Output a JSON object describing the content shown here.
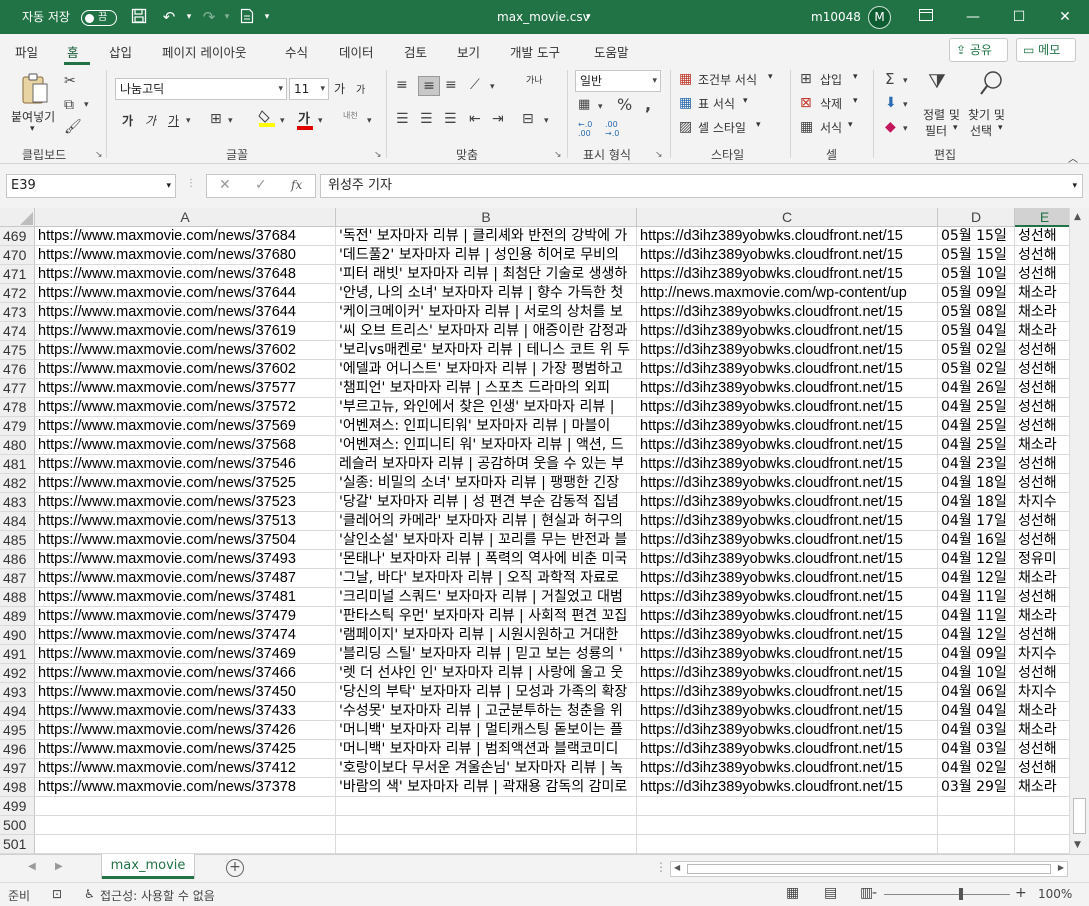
{
  "titlebar": {
    "autosave_label": "자동 저장",
    "autosave_state": "끔",
    "filename": "max_movie.csv",
    "user_name": "m10048",
    "user_initial": "M"
  },
  "menu": {
    "tabs": [
      "파일",
      "홈",
      "삽입",
      "페이지 레이아웃",
      "수식",
      "데이터",
      "검토",
      "보기",
      "개발 도구",
      "도움말"
    ],
    "share_label": "공유",
    "memo_label": "메모"
  },
  "ribbon": {
    "clipboard": {
      "paste_label": "붙여넣기",
      "group_label": "클립보드"
    },
    "font": {
      "font_name": "나눔고딕",
      "font_size": "11",
      "group_label": "글꼴",
      "bold": "가",
      "italic": "가",
      "underline": "가",
      "grow": "가",
      "shrink": "가",
      "color_glyph": "가",
      "phonetic": "내천"
    },
    "alignment": {
      "group_label": "맞춤",
      "wrap": "가나"
    },
    "number": {
      "format": "일반",
      "group_label": "표시 형식"
    },
    "styles": {
      "conditional": "조건부 서식",
      "table": "표 서식",
      "cell": "셀 스타일",
      "group_label": "스타일"
    },
    "cells": {
      "insert": "삽입",
      "delete": "삭제",
      "format": "서식",
      "group_label": "셀"
    },
    "editing": {
      "sort": "정렬 및",
      "sort2": "필터",
      "find": "찾기 및",
      "find2": "선택",
      "group_label": "편집"
    }
  },
  "formula": {
    "name_box": "E39",
    "content": "위성주 기자"
  },
  "columns": [
    "A",
    "B",
    "C",
    "D",
    "E"
  ],
  "rows": [
    {
      "n": "469",
      "a": "https://www.maxmovie.com/news/37684",
      "b": "'독전' 보자마자 리뷰 | 클리셰와 반전의 강박에 가",
      "c": "https://d3ihz389yobwks.cloudfront.net/15",
      "d": "05월 15일",
      "e": "성선해"
    },
    {
      "n": "470",
      "a": "https://www.maxmovie.com/news/37680",
      "b": "'데드풀2' 보자마자 리뷰 | 성인용 히어로 무비의",
      "c": "https://d3ihz389yobwks.cloudfront.net/15",
      "d": "05월 15일",
      "e": "성선해"
    },
    {
      "n": "471",
      "a": "https://www.maxmovie.com/news/37648",
      "b": "'피터 래빗' 보자마자 리뷰 | 최첨단 기술로 생생하",
      "c": "https://d3ihz389yobwks.cloudfront.net/15",
      "d": "05월 10일",
      "e": "성선해"
    },
    {
      "n": "472",
      "a": "https://www.maxmovie.com/news/37644",
      "b": "'안녕, 나의 소녀' 보자마자 리뷰 | 향수 가득한 첫",
      "c": "http://news.maxmovie.com/wp-content/up",
      "d": "05월 09일",
      "e": "채소라"
    },
    {
      "n": "473",
      "a": "https://www.maxmovie.com/news/37644",
      "b": "'케이크메이커' 보자마자 리뷰 | 서로의 상처를 보",
      "c": "https://d3ihz389yobwks.cloudfront.net/15",
      "d": "05월 08일",
      "e": "채소라"
    },
    {
      "n": "474",
      "a": "https://www.maxmovie.com/news/37619",
      "b": "'씨 오브 트리스' 보자마자 리뷰 | 애증이란 감정과",
      "c": "https://d3ihz389yobwks.cloudfront.net/15",
      "d": "05월 04일",
      "e": "채소라"
    },
    {
      "n": "475",
      "a": "https://www.maxmovie.com/news/37602",
      "b": "'보리vs매켄로' 보자마자 리뷰 | 테니스 코트 위 두",
      "c": "https://d3ihz389yobwks.cloudfront.net/15",
      "d": "05월 02일",
      "e": "성선해"
    },
    {
      "n": "476",
      "a": "https://www.maxmovie.com/news/37602",
      "b": "'에델과 어니스트' 보자마자 리뷰 | 가장 평범하고",
      "c": "https://d3ihz389yobwks.cloudfront.net/15",
      "d": "05월 02일",
      "e": "성선해"
    },
    {
      "n": "477",
      "a": "https://www.maxmovie.com/news/37577",
      "b": "'챔피언' 보자마자 리뷰 | 스포츠 드라마의 외피",
      "c": "https://d3ihz389yobwks.cloudfront.net/15",
      "d": "04월 26일",
      "e": "성선해"
    },
    {
      "n": "478",
      "a": "https://www.maxmovie.com/news/37572",
      "b": "'부르고뉴, 와인에서 찾은 인생' 보자마자 리뷰 |",
      "c": "https://d3ihz389yobwks.cloudfront.net/15",
      "d": "04월 25일",
      "e": "성선해"
    },
    {
      "n": "479",
      "a": "https://www.maxmovie.com/news/37569",
      "b": "'어벤져스: 인피니티워' 보자마자 리뷰 | 마블이",
      "c": "https://d3ihz389yobwks.cloudfront.net/15",
      "d": "04월 25일",
      "e": "성선해"
    },
    {
      "n": "480",
      "a": "https://www.maxmovie.com/news/37568",
      "b": "'어벤져스: 인피니티 워' 보자마자 리뷰 | 액션, 드",
      "c": "https://d3ihz389yobwks.cloudfront.net/15",
      "d": "04월 25일",
      "e": "채소라"
    },
    {
      "n": "481",
      "a": "https://www.maxmovie.com/news/37546",
      "b": "레슬러 보자마자 리뷰 | 공감하며 웃을 수 있는 부",
      "c": "https://d3ihz389yobwks.cloudfront.net/15",
      "d": "04월 23일",
      "e": "성선해"
    },
    {
      "n": "482",
      "a": "https://www.maxmovie.com/news/37525",
      "b": "'실종: 비밀의 소녀' 보자마자 리뷰 | 팽팽한 긴장",
      "c": "https://d3ihz389yobwks.cloudfront.net/15",
      "d": "04월 18일",
      "e": "성선해"
    },
    {
      "n": "483",
      "a": "https://www.maxmovie.com/news/37523",
      "b": "'당갈' 보자마자 리뷰 | 성 편견 부순 감동적 집념",
      "c": "https://d3ihz389yobwks.cloudfront.net/15",
      "d": "04월 18일",
      "e": "차지수"
    },
    {
      "n": "484",
      "a": "https://www.maxmovie.com/news/37513",
      "b": "'클레어의 카메라' 보자마자 리뷰 | 현실과 허구의",
      "c": "https://d3ihz389yobwks.cloudfront.net/15",
      "d": "04월 17일",
      "e": "성선해"
    },
    {
      "n": "485",
      "a": "https://www.maxmovie.com/news/37504",
      "b": "'살인소설' 보자마자 리뷰 | 꼬리를 무는 반전과 블",
      "c": "https://d3ihz389yobwks.cloudfront.net/15",
      "d": "04월 16일",
      "e": "성선해"
    },
    {
      "n": "486",
      "a": "https://www.maxmovie.com/news/37493",
      "b": "'몬태나' 보자마자 리뷰 | 폭력의 역사에 비춘 미국",
      "c": "https://d3ihz389yobwks.cloudfront.net/15",
      "d": "04월 12일",
      "e": "정유미"
    },
    {
      "n": "487",
      "a": "https://www.maxmovie.com/news/37487",
      "b": "'그날, 바다' 보자마자 리뷰 | 오직 과학적 자료로",
      "c": "https://d3ihz389yobwks.cloudfront.net/15",
      "d": "04월 12일",
      "e": "채소라"
    },
    {
      "n": "488",
      "a": "https://www.maxmovie.com/news/37481",
      "b": "'크리미널 스쿼드' 보자마자 리뷰 | 거칠었고 대범",
      "c": "https://d3ihz389yobwks.cloudfront.net/15",
      "d": "04월 11일",
      "e": "성선해"
    },
    {
      "n": "489",
      "a": "https://www.maxmovie.com/news/37479",
      "b": "'판타스틱 우먼' 보자마자 리뷰 | 사회적 편견 꼬집",
      "c": "https://d3ihz389yobwks.cloudfront.net/15",
      "d": "04월 11일",
      "e": "채소라"
    },
    {
      "n": "490",
      "a": "https://www.maxmovie.com/news/37474",
      "b": "'램페이지' 보자마자 리뷰 | 시원시원하고 거대한",
      "c": "https://d3ihz389yobwks.cloudfront.net/15",
      "d": "04월 12일",
      "e": "성선해"
    },
    {
      "n": "491",
      "a": "https://www.maxmovie.com/news/37469",
      "b": "'블리딩 스틸' 보자마자 리뷰 | 믿고 보는 성룡의 '",
      "c": "https://d3ihz389yobwks.cloudfront.net/15",
      "d": "04월 09일",
      "e": "차지수"
    },
    {
      "n": "492",
      "a": "https://www.maxmovie.com/news/37466",
      "b": "'렛 더 선샤인 인' 보자마자 리뷰 | 사랑에 울고 웃",
      "c": "https://d3ihz389yobwks.cloudfront.net/15",
      "d": "04월 10일",
      "e": "성선해"
    },
    {
      "n": "493",
      "a": "https://www.maxmovie.com/news/37450",
      "b": "'당신의 부탁' 보자마자 리뷰 | 모성과 가족의 확장",
      "c": "https://d3ihz389yobwks.cloudfront.net/15",
      "d": "04월 06일",
      "e": "차지수"
    },
    {
      "n": "494",
      "a": "https://www.maxmovie.com/news/37433",
      "b": "'수성못' 보자마자 리뷰 | 고군분투하는 청춘을 위",
      "c": "https://d3ihz389yobwks.cloudfront.net/15",
      "d": "04월 04일",
      "e": "채소라"
    },
    {
      "n": "495",
      "a": "https://www.maxmovie.com/news/37426",
      "b": "'머니백' 보자마자 리뷰 | 멀티캐스팅 돋보이는 플",
      "c": "https://d3ihz389yobwks.cloudfront.net/15",
      "d": "04월 03일",
      "e": "채소라"
    },
    {
      "n": "496",
      "a": "https://www.maxmovie.com/news/37425",
      "b": "'머니백' 보자마자 리뷰 | 범죄액션과 블랙코미디",
      "c": "https://d3ihz389yobwks.cloudfront.net/15",
      "d": "04월 03일",
      "e": "성선해"
    },
    {
      "n": "497",
      "a": "https://www.maxmovie.com/news/37412",
      "b": "'호랑이보다 무서운 겨울손님' 보자마자 리뷰 | 녹",
      "c": "https://d3ihz389yobwks.cloudfront.net/15",
      "d": "04월 02일",
      "e": "성선해"
    },
    {
      "n": "498",
      "a": "https://www.maxmovie.com/news/37378",
      "b": "'바람의 색' 보자마자 리뷰 | 곽재용 감독의 감미로",
      "c": "https://d3ihz389yobwks.cloudfront.net/15",
      "d": "03월 29일",
      "e": "채소라"
    },
    {
      "n": "499",
      "a": "",
      "b": "",
      "c": "",
      "d": "",
      "e": ""
    },
    {
      "n": "500",
      "a": "",
      "b": "",
      "c": "",
      "d": "",
      "e": ""
    },
    {
      "n": "501",
      "a": "",
      "b": "",
      "c": "",
      "d": "",
      "e": ""
    }
  ],
  "sheets": [
    "max_movie"
  ],
  "status": {
    "ready": "준비",
    "accessibility": "접근성: 사용할 수 없음",
    "zoom": "100%"
  },
  "colors": {
    "accent": "#217346"
  }
}
